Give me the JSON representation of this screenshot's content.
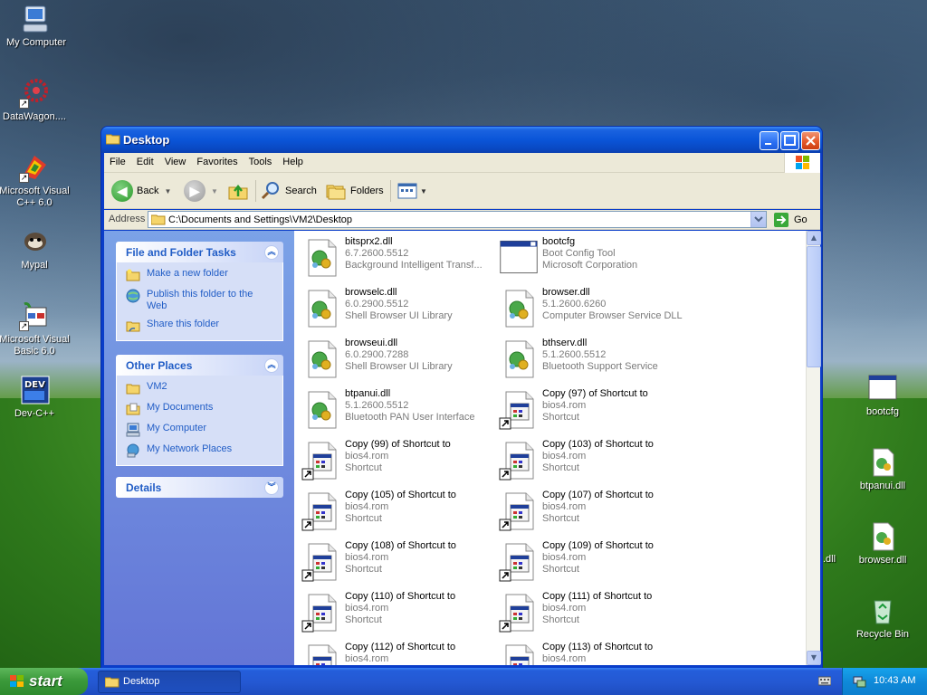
{
  "desktop": {
    "left_icons": [
      {
        "label": "My Computer",
        "icon": "my-computer-icon"
      },
      {
        "label": "DataWagon....",
        "icon": "datawagon-icon"
      },
      {
        "label": "Microsoft Visual C++ 6.0",
        "icon": "visual-cpp-icon"
      },
      {
        "label": "Mypal",
        "icon": "mypal-icon"
      },
      {
        "label": "Microsoft Visual Basic 6.0",
        "icon": "visual-basic-icon"
      },
      {
        "label": "Dev-C++",
        "icon": "dev-cpp-icon"
      }
    ],
    "right_icons": [
      {
        "label": "bootcfg",
        "icon": "bootcfg-icon"
      },
      {
        "label": "btpanui.dll",
        "icon": "dll-icon"
      },
      {
        "label": "browser.dll",
        "icon": "dll-icon"
      },
      {
        "label": "Recycle Bin",
        "icon": "recycle-bin-icon"
      }
    ],
    "partial_label": ".dll"
  },
  "window": {
    "title": "Desktop",
    "menu": [
      "File",
      "Edit",
      "View",
      "Favorites",
      "Tools",
      "Help"
    ],
    "toolbar": {
      "back": "Back",
      "search": "Search",
      "folders": "Folders"
    },
    "address": {
      "label": "Address",
      "value": "C:\\Documents and Settings\\VM2\\Desktop",
      "go": "Go"
    },
    "tasks_panel": {
      "title": "File and Folder Tasks",
      "items": [
        "Make a new folder",
        "Publish this folder to the Web",
        "Share this folder"
      ]
    },
    "places_panel": {
      "title": "Other Places",
      "items": [
        "VM2",
        "My Documents",
        "My Computer",
        "My Network Places"
      ]
    },
    "details_panel": {
      "title": "Details"
    },
    "files": [
      {
        "name": "bitsprx2.dll",
        "line2": "6.7.2600.5512",
        "line3": "Background Intelligent Transf...",
        "kind": "dll"
      },
      {
        "name": "bootcfg",
        "line2": "Boot Config Tool",
        "line3": "Microsoft Corporation",
        "kind": "exe"
      },
      {
        "name": "browselc.dll",
        "line2": "6.0.2900.5512",
        "line3": "Shell Browser UI Library",
        "kind": "dll"
      },
      {
        "name": "browser.dll",
        "line2": "5.1.2600.6260",
        "line3": "Computer Browser Service DLL",
        "kind": "dll"
      },
      {
        "name": "browseui.dll",
        "line2": "6.0.2900.7288",
        "line3": "Shell Browser UI Library",
        "kind": "dll"
      },
      {
        "name": "bthserv.dll",
        "line2": "5.1.2600.5512",
        "line3": "Bluetooth Support Service",
        "kind": "dll"
      },
      {
        "name": "btpanui.dll",
        "line2": "5.1.2600.5512",
        "line3": "Bluetooth PAN User Interface",
        "kind": "dll"
      },
      {
        "name": "Copy (97) of Shortcut to",
        "line2": "bios4.rom",
        "line3": "Shortcut",
        "kind": "shortcut"
      },
      {
        "name": "Copy (99) of Shortcut to",
        "line2": "bios4.rom",
        "line3": "Shortcut",
        "kind": "shortcut"
      },
      {
        "name": "Copy (103) of Shortcut to",
        "line2": "bios4.rom",
        "line3": "Shortcut",
        "kind": "shortcut"
      },
      {
        "name": "Copy (105) of Shortcut to",
        "line2": "bios4.rom",
        "line3": "Shortcut",
        "kind": "shortcut"
      },
      {
        "name": "Copy (107) of Shortcut to",
        "line2": "bios4.rom",
        "line3": "Shortcut",
        "kind": "shortcut"
      },
      {
        "name": "Copy (108) of Shortcut to",
        "line2": "bios4.rom",
        "line3": "Shortcut",
        "kind": "shortcut"
      },
      {
        "name": "Copy (109) of Shortcut to",
        "line2": "bios4.rom",
        "line3": "Shortcut",
        "kind": "shortcut"
      },
      {
        "name": "Copy (110) of Shortcut to",
        "line2": "bios4.rom",
        "line3": "Shortcut",
        "kind": "shortcut"
      },
      {
        "name": "Copy (111) of Shortcut to",
        "line2": "bios4.rom",
        "line3": "Shortcut",
        "kind": "shortcut"
      },
      {
        "name": "Copy (112) of Shortcut to",
        "line2": "bios4.rom",
        "line3": "",
        "kind": "shortcut"
      },
      {
        "name": "Copy (113) of Shortcut to",
        "line2": "bios4.rom",
        "line3": "",
        "kind": "shortcut"
      }
    ]
  },
  "taskbar": {
    "start": "start",
    "task_button": "Desktop",
    "clock": "10:43 AM"
  }
}
